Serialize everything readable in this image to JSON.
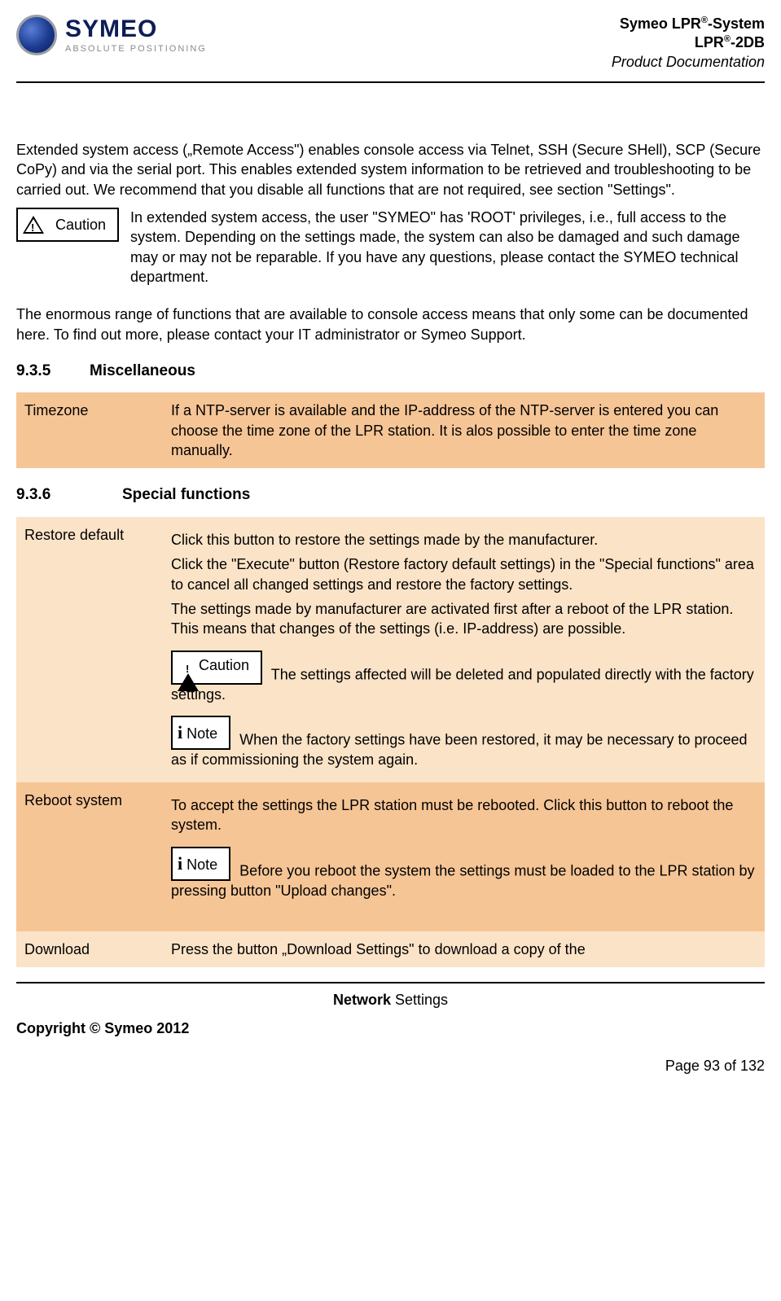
{
  "header": {
    "brand": "SYMEO",
    "tagline": "ABSOLUTE POSITIONING",
    "line1_pre": "Symeo LPR",
    "line1_sup": "®",
    "line1_post": "-System",
    "line2_pre": "LPR",
    "line2_sup": "®",
    "line2_post": "-2DB",
    "line3": "Product Documentation"
  },
  "intro_para": "Extended system access („Remote Access\") enables console access via Telnet, SSH (Secure SHell), SCP (Secure CoPy) and via the serial port. This enables extended system information to be retrieved and troubleshooting to be carried out. We recommend that you disable all functions that are not required, see section \"Settings\".",
  "caution_label": "Caution",
  "note_label": "Note",
  "caution_text": "In extended system access, the user \"SYMEO\" has 'ROOT' privileges, i.e., full access to the system. Depending on the settings made, the system can also be damaged and such damage may or may not be reparable. If you have any questions, please contact the SYMEO technical department.",
  "range_para": "The enormous range of functions that are available to console access means that only some can be documented here. To find out more, please contact your IT administrator or Symeo Support.",
  "sec935": {
    "num": "9.3.5",
    "title": "Miscellaneous"
  },
  "timezone": {
    "label": "Timezone",
    "text": "If a NTP-server is available and the IP-address of the NTP-server is entered you can choose the time zone of the LPR station. It is alos possible to enter the time zone manually."
  },
  "sec936": {
    "num": "9.3.6",
    "title": "Special functions"
  },
  "restore": {
    "label": "Restore default",
    "p1": "Click this button to restore the settings made by the manufacturer.",
    "p2": "Click the \"Execute\" button (Restore factory default settings) in the \"Special functions\" area to cancel all changed settings and restore the factory settings.",
    "p3": "The settings made by manufacturer are activated first after a reboot of the LPR station. This means that changes of the settings (i.e. IP-address) are possible.",
    "caution_after": " The settings affected will be deleted and populated directly with the factory settings.",
    "note_after": " When the factory settings have been restored, it may be necessary to proceed as if commissioning the system again."
  },
  "reboot": {
    "label": "Reboot system",
    "p1": "To accept the settings the LPR station must be rebooted. Click this button to reboot the system.",
    "note_after": " Before you reboot the system the settings must be loaded to the LPR station by pressing button \"Upload changes\"."
  },
  "download": {
    "label": "Download",
    "text": "Press the button „Download Settings\" to download a copy of the"
  },
  "footer": {
    "center_bold": "Network",
    "center_rest": " Settings",
    "copyright": "Copyright © Symeo 2012",
    "page": "Page 93 of 132"
  }
}
